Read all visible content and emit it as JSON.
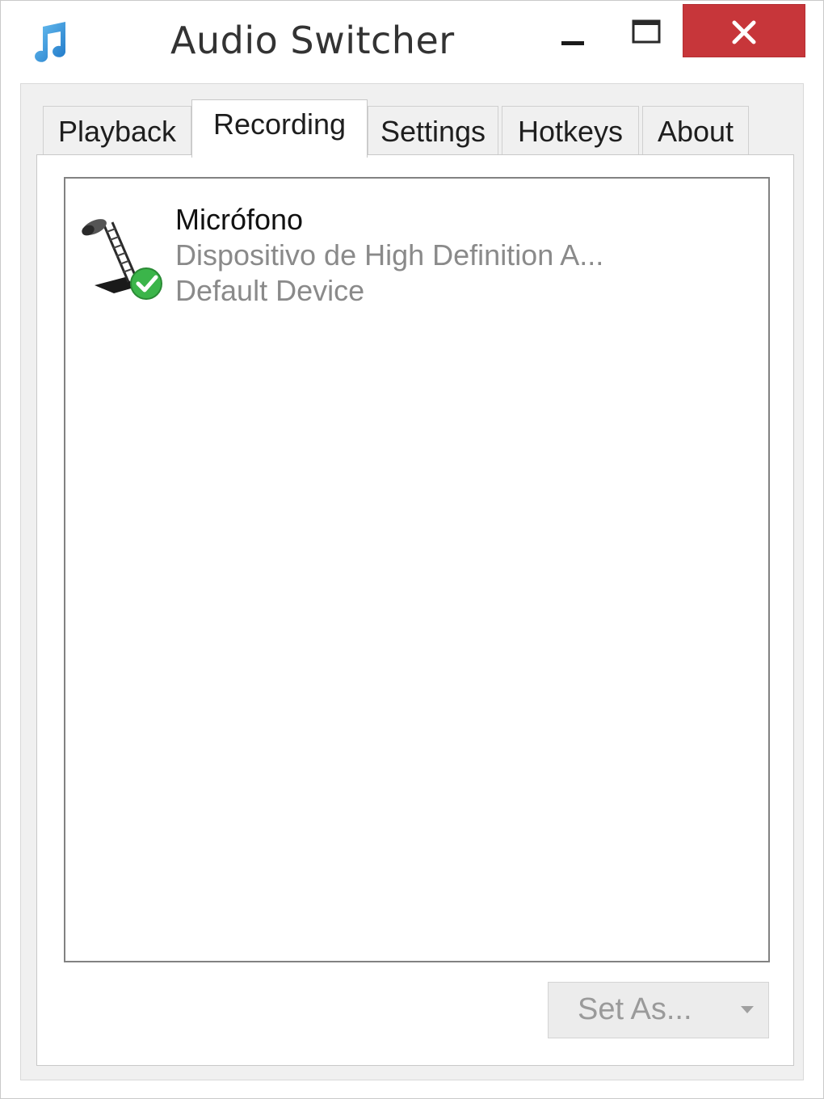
{
  "window": {
    "title": "Audio Switcher",
    "app_icon": "music-note-icon",
    "controls": {
      "minimize_icon": "minimize-icon",
      "maximize_icon": "maximize-icon",
      "close_icon": "close-icon",
      "close_color": "#c7363a"
    }
  },
  "tabs": [
    {
      "label": "Playback",
      "active": false
    },
    {
      "label": "Recording",
      "active": true
    },
    {
      "label": "Settings",
      "active": false
    },
    {
      "label": "Hotkeys",
      "active": false
    },
    {
      "label": "About",
      "active": false
    }
  ],
  "devices": [
    {
      "name": "Micrófono",
      "description": "Dispositivo de High Definition A...",
      "status": "Default Device",
      "icon": "microphone-icon",
      "badge_icon": "check-badge-icon"
    }
  ],
  "set_as_button": {
    "label": "Set As...",
    "icon": "dropdown-arrow-icon"
  },
  "colors": {
    "accent_blue": "#2f8fd8",
    "check_green": "#3bb54a",
    "secondary_text": "#8a8a8a"
  }
}
